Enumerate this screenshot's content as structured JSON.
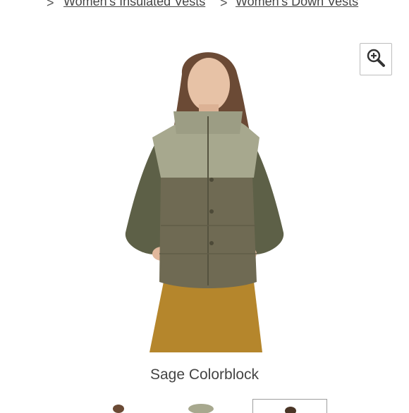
{
  "breadcrumb": {
    "separator": ">",
    "items": [
      "Women's Insulated Vests",
      "Women's Down Vests"
    ]
  },
  "zoom": {
    "icon": "zoom-in-icon"
  },
  "product": {
    "color_name": "Sage Colorblock",
    "image": "product-photo"
  },
  "thumbnails": {
    "count_visible": 3,
    "selected_index": 2
  },
  "colors": {
    "text": "#444444",
    "border": "#bdbdbd",
    "vest_light": "#a7a88e",
    "vest_dark": "#6f6a53",
    "pants": "#b5862c"
  }
}
